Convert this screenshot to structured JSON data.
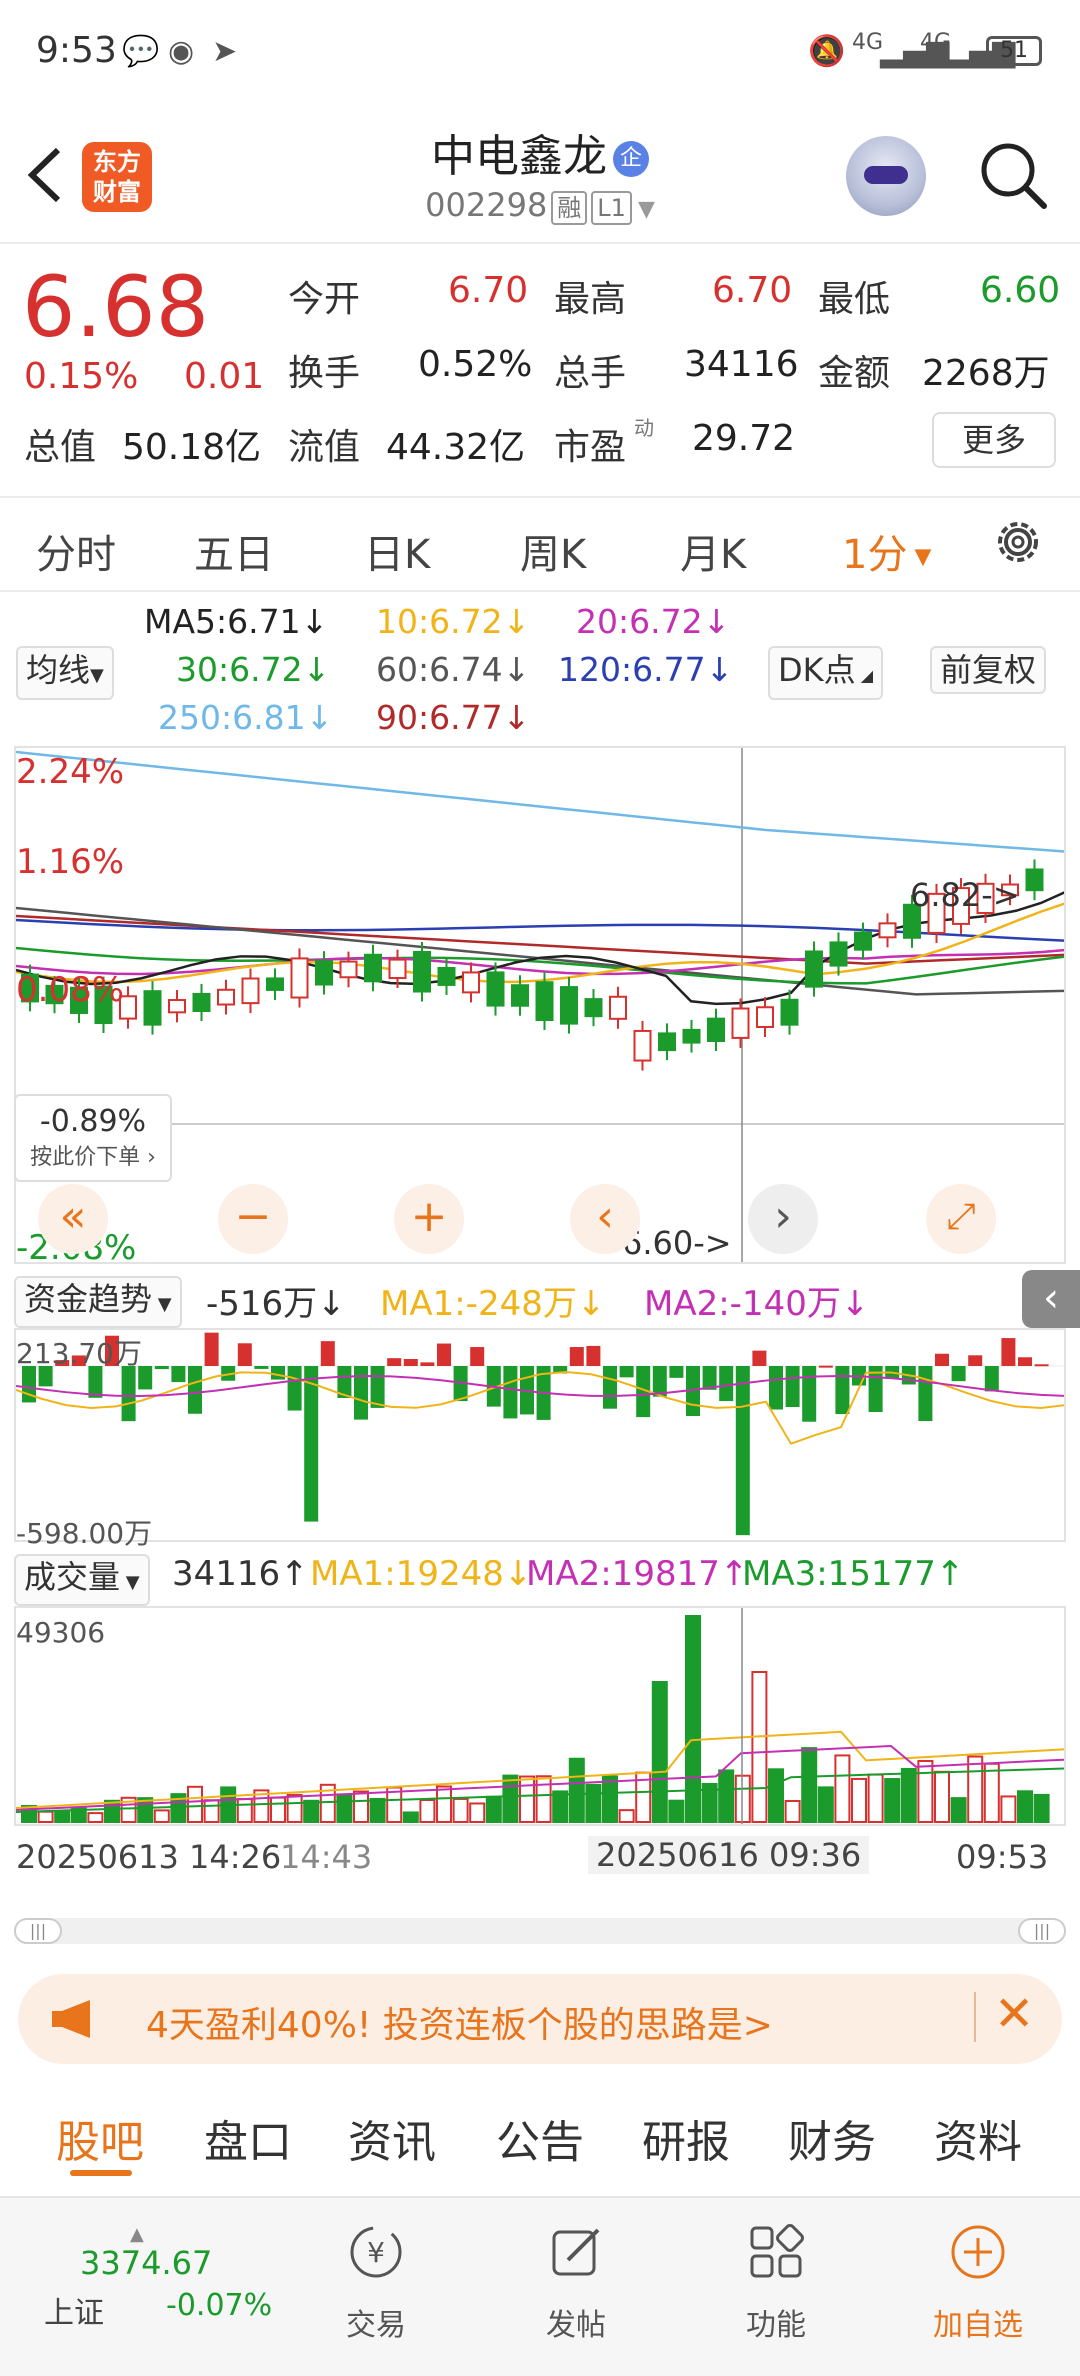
{
  "status_bar": {
    "time": "9:53",
    "battery": "51",
    "signal_1": "4G",
    "signal_2": "4G"
  },
  "header": {
    "stock_name": "中电鑫龙",
    "badge": "企",
    "stock_code": "002298",
    "tag_margin": "融",
    "tag_level": "L1",
    "logo_line1": "东方",
    "logo_line2": "财富"
  },
  "quote": {
    "price": "6.68",
    "change_pct": "0.15%",
    "change": "0.01",
    "open_label": "今开",
    "open": "6.70",
    "high_label": "最高",
    "high": "6.70",
    "low_label": "最低",
    "low": "6.60",
    "turnover_label": "换手",
    "turnover": "0.52%",
    "volume_label": "总手",
    "volume": "34116",
    "amount_label": "金额",
    "amount": "2268万",
    "mktcap_label": "总值",
    "mktcap": "50.18亿",
    "float_label": "流值",
    "float_cap": "44.32亿",
    "pe_label": "市盈",
    "pe_sup": "动",
    "pe": "29.72",
    "more": "更多"
  },
  "chart_tabs": [
    "分时",
    "五日",
    "日K",
    "周K",
    "月K",
    "1分"
  ],
  "ma_legend": {
    "selector": "均线",
    "ma5": "MA5:6.71↓",
    "ma10": "10:6.72↓",
    "ma20": "20:6.72↓",
    "ma30": "30:6.72↓",
    "ma60": "60:6.74↓",
    "ma120": "120:6.77↓",
    "ma250": "250:6.81↓",
    "ma90": "90:6.77↓",
    "dk_button": "DK点",
    "adjust_button": "前复权"
  },
  "kline": {
    "y_labels": [
      "2.24%",
      "1.16%",
      "0.08%",
      "-2.08%"
    ],
    "price_tag": "-0.89%",
    "order_hint": "按此价下单",
    "hi_marker": "6.82->",
    "lo_marker": "6.60->"
  },
  "fund_flow": {
    "selector": "资金趋势",
    "value": "-516万↓",
    "ma1": "MA1:-248万↓",
    "ma2": "MA2:-140万↓",
    "top": "213.70万",
    "bottom": "-598.00万"
  },
  "volume_panel": {
    "selector": "成交量",
    "value": "34116↑",
    "ma1": "MA1:19248↓",
    "ma2": "MA2:19817↑",
    "ma3": "MA3:15177↑",
    "top": "49306"
  },
  "time_axis": {
    "t1": "20250613 14:26",
    "t2": "14:43",
    "t3": "20250616 09:36",
    "t4": "09:53"
  },
  "ad": {
    "text": "4天盈利40%!  投资连板个股的思路是>"
  },
  "bottom_tabs": [
    "股吧",
    "盘口",
    "资讯",
    "公告",
    "研报",
    "财务",
    "资料"
  ],
  "bottom_nav": {
    "index_value": "3374.67",
    "index_name": "上证",
    "index_change": "-0.07%",
    "trade": "交易",
    "post": "发帖",
    "func": "功能",
    "add": "加自选"
  },
  "colors": {
    "up": "#d6312f",
    "down": "#1a9b2b",
    "accent": "#e8741c",
    "ma5": "#222222",
    "ma10": "#f0b418",
    "ma20": "#c330b4",
    "ma30": "#1a9b2b",
    "ma60": "#555555",
    "ma120": "#2a3fb0",
    "ma250": "#6fb8e8",
    "ma90": "#b02a2a"
  }
}
